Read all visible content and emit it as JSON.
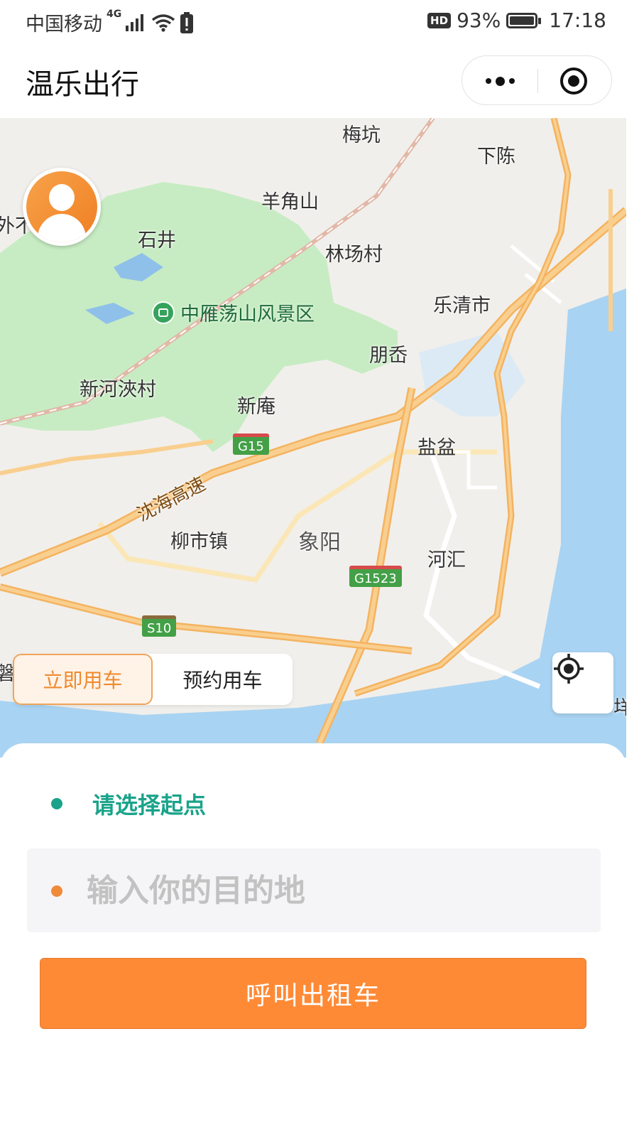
{
  "status_bar": {
    "carrier": "中国移动",
    "network": "4G",
    "hd": "HD",
    "battery_text": "93%",
    "battery_level": 0.93,
    "time": "17:18"
  },
  "header": {
    "title": "温乐出行",
    "more_icon": "more-dots-icon",
    "close_icon": "target-close-icon"
  },
  "map": {
    "places": {
      "meikeng": "梅坑",
      "xiachen": "下陈",
      "yangjiaoshan": "羊角山",
      "shijing": "石井",
      "linchangcun": "林场村",
      "yueqingshi": "乐清市",
      "scenic": "中雁荡山风景区",
      "pengdai": "朋岙",
      "xinhejiacun": "新河浹村",
      "xinan": "新庵",
      "yanpen": "盐盆",
      "liushizhen": "柳市镇",
      "xiangyang": "象阳",
      "hehui": "河汇",
      "edge_left": "外不",
      "edge_left2": "磐",
      "edge_right": "垟"
    },
    "roads": {
      "g15": "G15",
      "g1523": "G1523",
      "s10": "S10",
      "shenhai": "沈海高速"
    },
    "colors": {
      "land": "#f1efeb",
      "green": "#c7ecc3",
      "water": "#a9d3f2",
      "highway": "#f7c07a"
    }
  },
  "mode_tabs": {
    "now": "立即用车",
    "reserve": "预约用车"
  },
  "panel": {
    "origin_placeholder": "请选择起点",
    "destination_placeholder": "输入你的目的地",
    "call_button": "呼叫出租车"
  }
}
